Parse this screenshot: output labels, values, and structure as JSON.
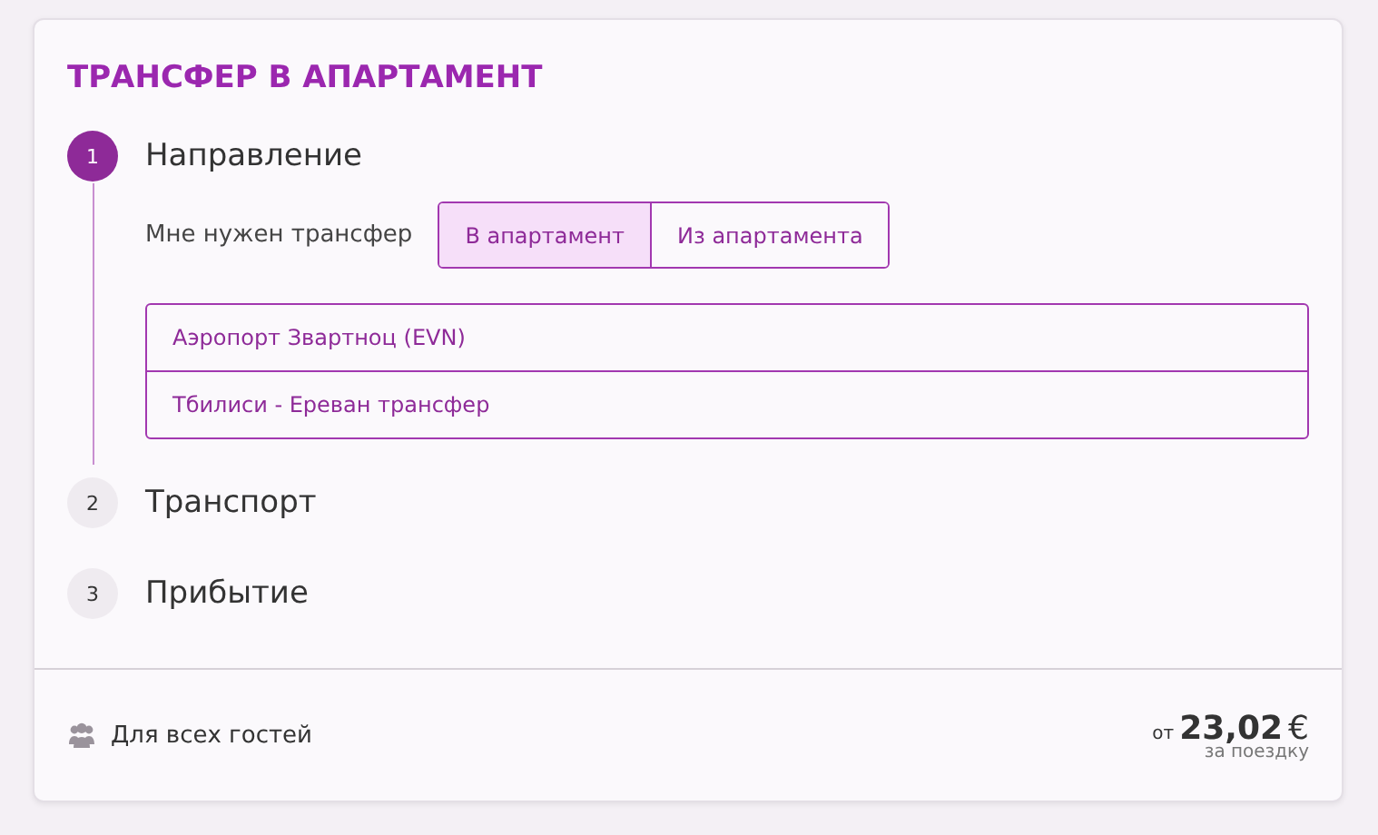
{
  "title": "ТРАНСФЕР В АПАРТАМЕНТ",
  "steps": [
    {
      "number": "1",
      "title": "Направление",
      "active": true
    },
    {
      "number": "2",
      "title": "Транспорт",
      "active": false
    },
    {
      "number": "3",
      "title": "Прибытие",
      "active": false
    }
  ],
  "direction": {
    "label": "Мне нужен трансфер",
    "options": [
      {
        "label": "В апартамент",
        "selected": true
      },
      {
        "label": "Из апартамента",
        "selected": false
      }
    ],
    "destinations": [
      "Аэропорт Звартноц (EVN)",
      "Тбилиси - Ереван трансфер"
    ]
  },
  "footer": {
    "guests": "Для всех гостей",
    "price_prefix": "от",
    "price": "23,02",
    "currency": "€",
    "price_note": "за поездку"
  }
}
